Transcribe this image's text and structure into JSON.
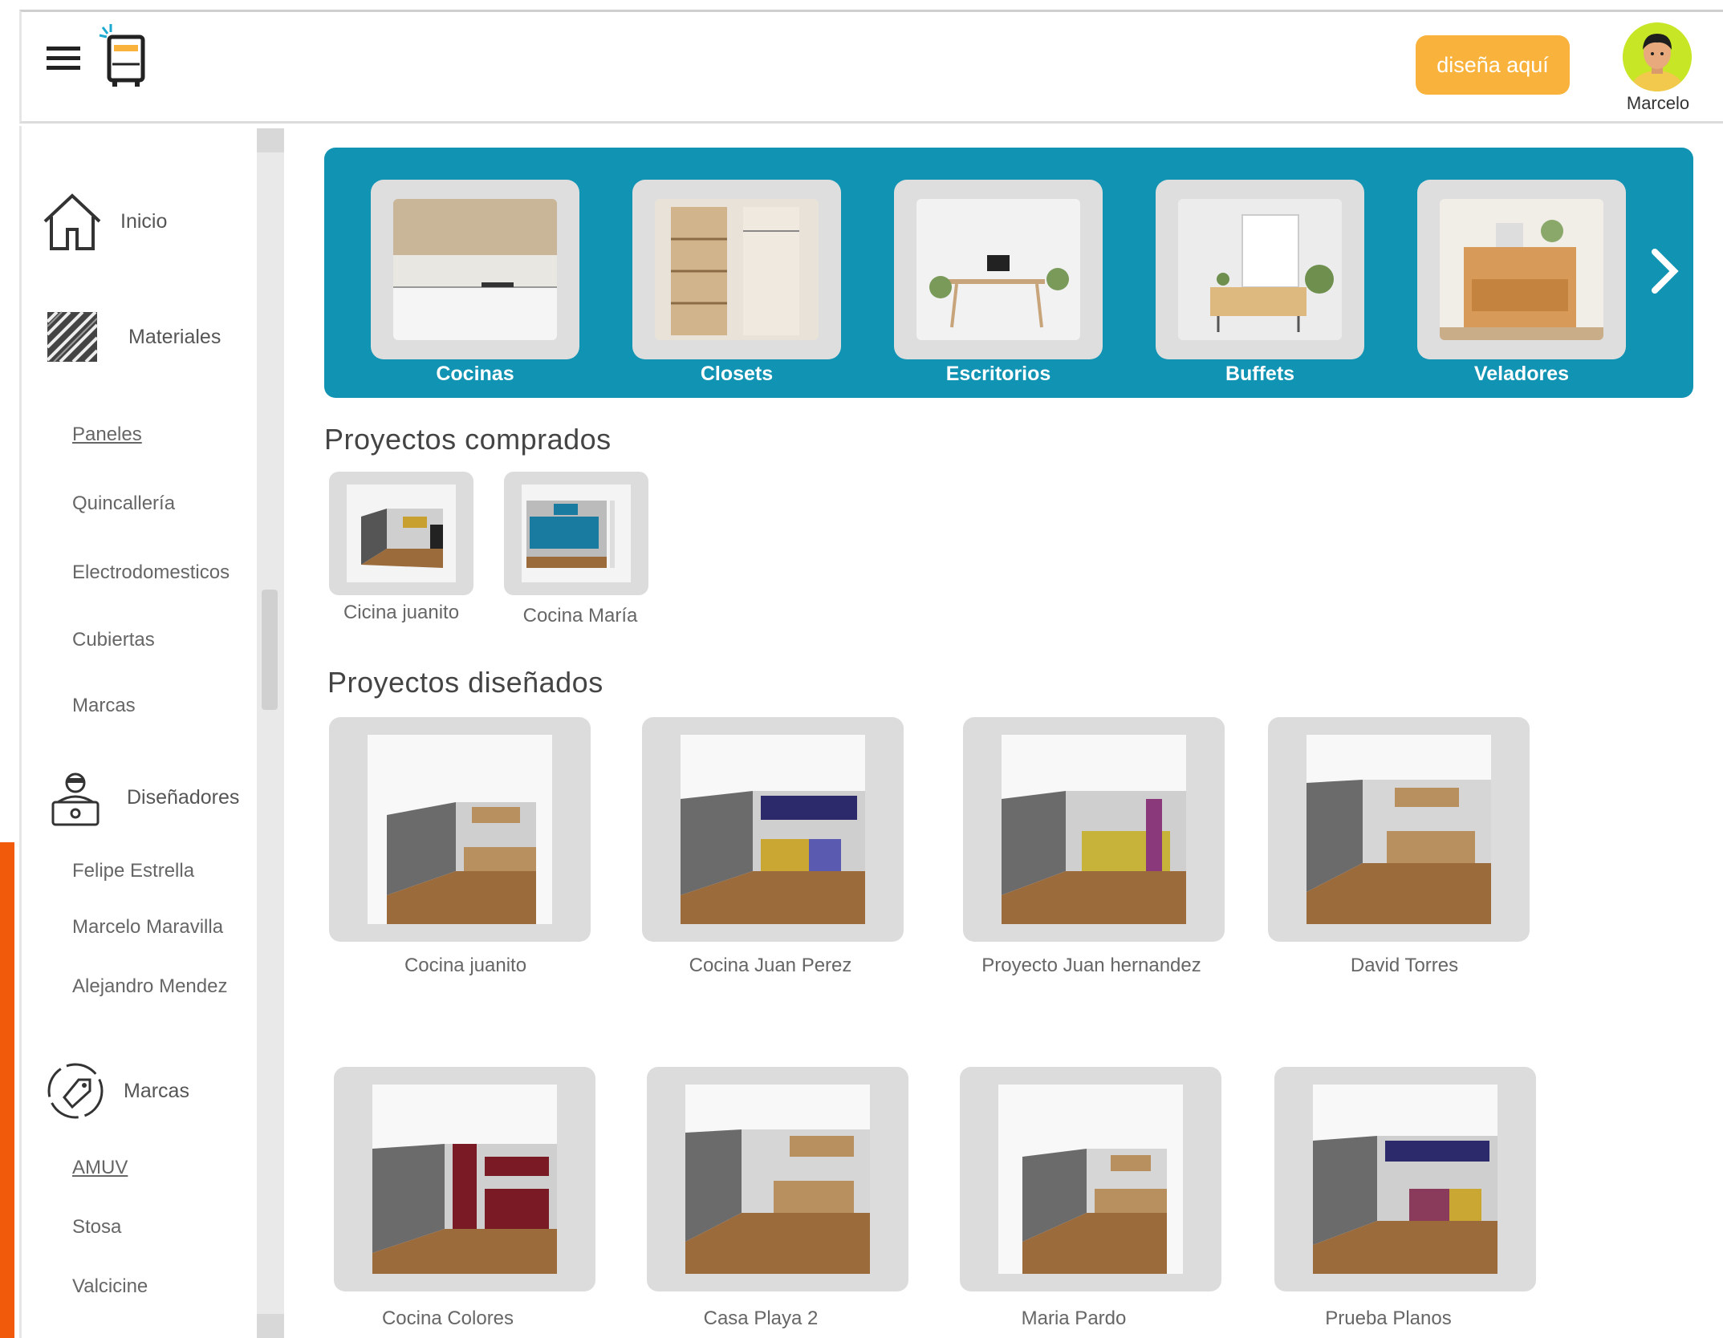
{
  "header": {
    "design_button": "diseña aquí",
    "user_name": "Marcelo"
  },
  "sidebar": {
    "inicio": "Inicio",
    "materiales": "Materiales",
    "materiales_items": [
      "Paneles",
      "Quincallería",
      "Electrodomesticos",
      "Cubiertas",
      "Marcas"
    ],
    "disenadores": "Diseñadores",
    "disenadores_items": [
      "Felipe Estrella",
      "Marcelo Maravilla",
      "Alejandro Mendez"
    ],
    "marcas": "Marcas",
    "marcas_items": [
      "AMUV",
      "Stosa",
      "Valcicine"
    ]
  },
  "categories": [
    {
      "label": "Cocinas"
    },
    {
      "label": "Closets"
    },
    {
      "label": "Escritorios"
    },
    {
      "label": "Buffets"
    },
    {
      "label": "Veladores"
    }
  ],
  "purchased": {
    "title": "Proyectos comprados",
    "items": [
      {
        "label": "Cicina juanito"
      },
      {
        "label": "Cocina  María"
      }
    ]
  },
  "designed": {
    "title": "Proyectos diseñados",
    "items": [
      {
        "label": "Cocina juanito"
      },
      {
        "label": "Cocina  Juan Perez"
      },
      {
        "label": "Proyecto Juan hernandez"
      },
      {
        "label": "David Torres"
      },
      {
        "label": "Cocina Colores"
      },
      {
        "label": "Casa Playa 2"
      },
      {
        "label": "Maria Pardo"
      },
      {
        "label": "Prueba Planos"
      }
    ]
  },
  "colors": {
    "banner": "#1193b3",
    "accent_button": "#f9b33d",
    "orange_strip": "#f05a0a"
  }
}
